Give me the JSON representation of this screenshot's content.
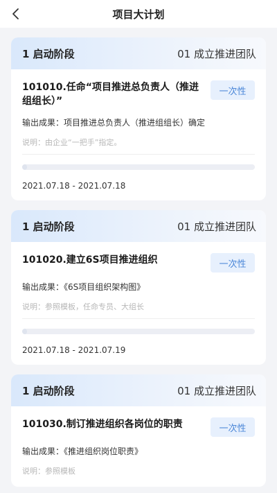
{
  "header": {
    "title": "项目大计划",
    "back_icon": "chevron-left-icon"
  },
  "cards": [
    {
      "stage": "1 启动阶段",
      "team": "01 成立推进团队",
      "task": "101010.任命“项目推进总负责人（推进组组长）”",
      "badge": "一次性",
      "output": "输出成果：项目推进总负责人（推进组组长）确定",
      "note": "说明：由企业“一把手”指定。",
      "progress": 0,
      "dates": "2021.07.18 - 2021.07.18"
    },
    {
      "stage": "1 启动阶段",
      "team": "01 成立推进团队",
      "task": "101020.建立6S项目推进组织",
      "badge": "一次性",
      "output": "输出成果：《6S项目组织架构图》",
      "note": "说明：参照模板，任命专员、大组长",
      "progress": 0,
      "dates": "2021.07.18 - 2021.07.19"
    },
    {
      "stage": "1 启动阶段",
      "team": "01 成立推进团队",
      "task": "101030.制订推进组织各岗位的职责",
      "badge": "一次性",
      "output": "输出成果：《推进组织岗位职责》",
      "note": "说明：参照模板",
      "progress": 0,
      "dates": ""
    }
  ]
}
